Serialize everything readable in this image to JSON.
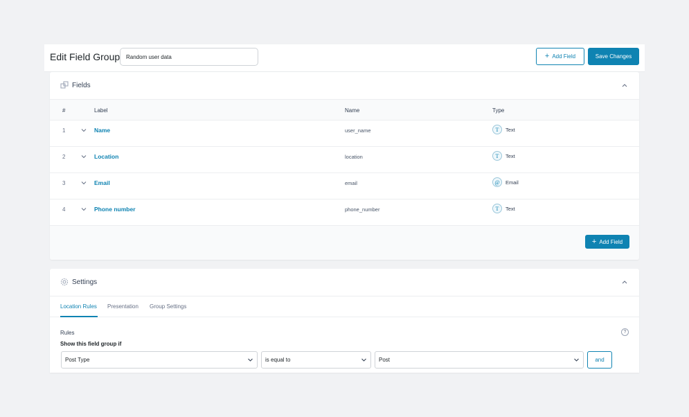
{
  "header": {
    "title": "Edit Field Group",
    "group_name_value": "Random user data",
    "add_field_label": "Add Field",
    "save_label": "Save Changes"
  },
  "fields_panel": {
    "title": "Fields",
    "columns": {
      "num": "#",
      "label": "Label",
      "name": "Name",
      "type": "Type"
    },
    "rows": [
      {
        "num": "1",
        "label": "Name",
        "name": "user_name",
        "type": "Text",
        "type_icon": "T"
      },
      {
        "num": "2",
        "label": "Location",
        "name": "location",
        "type": "Text",
        "type_icon": "T"
      },
      {
        "num": "3",
        "label": "Email",
        "name": "email",
        "type": "Email",
        "type_icon": "@"
      },
      {
        "num": "4",
        "label": "Phone number",
        "name": "phone_number",
        "type": "Text",
        "type_icon": "T"
      }
    ],
    "add_field_label": "Add Field"
  },
  "settings_panel": {
    "title": "Settings",
    "tabs": [
      "Location Rules",
      "Presentation",
      "Group Settings"
    ],
    "rules_label": "Rules",
    "rules_sub": "Show this field group if",
    "help_glyph": "?",
    "rule": {
      "param": "Post Type",
      "operator": "is equal to",
      "value": "Post"
    },
    "and_label": "and"
  },
  "colors": {
    "accent": "#0f83b2",
    "background": "#f1f2f4"
  }
}
